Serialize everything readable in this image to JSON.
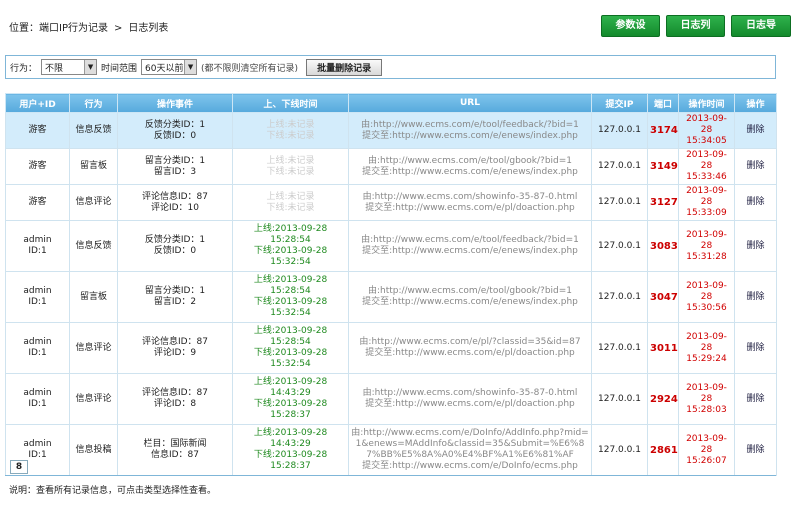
{
  "breadcrumb": {
    "prefix": "位置：",
    "parent": "端口IP行为记录",
    "sep": ">",
    "current": "日志列表"
  },
  "top_buttons": [
    "参数设置",
    "日志列表",
    "日志导出"
  ],
  "filter": {
    "behavior_label": "行为：",
    "behavior_value": "不限",
    "time_label": "时间范围",
    "time_value": "60天以前",
    "hint": "(都不限则清空所有记录)",
    "batch_delete": "批量删除记录"
  },
  "columns": [
    "用户+ID",
    "行为",
    "操作事件",
    "上、下线时间",
    "URL",
    "提交IP",
    "端口",
    "操作时间",
    "操作"
  ],
  "rows": [
    {
      "user": [
        "游客"
      ],
      "action": "信息反馈",
      "event": [
        "反馈分类ID：1",
        "反馈ID：0"
      ],
      "online": [
        "上线:未记录",
        "下线:未记录"
      ],
      "online_faded": true,
      "url_from": "由:http://www.ecms.com/e/tool/feedback/?bid=1",
      "url_to": "提交至:http://www.ecms.com/e/enews/index.php",
      "ip": "127.0.0.1",
      "port": "3174",
      "time": [
        "2013-09-28",
        "15:34:05"
      ],
      "op": "删除",
      "highlight": true
    },
    {
      "user": [
        "游客"
      ],
      "action": "留言板",
      "event": [
        "留言分类ID：1",
        "留言ID：3"
      ],
      "online": [
        "上线:未记录",
        "下线:未记录"
      ],
      "online_faded": true,
      "url_from": "由:http://www.ecms.com/e/tool/gbook/?bid=1",
      "url_to": "提交至:http://www.ecms.com/e/enews/index.php",
      "ip": "127.0.0.1",
      "port": "3149",
      "time": [
        "2013-09-28",
        "15:33:46"
      ],
      "op": "删除"
    },
    {
      "user": [
        "游客"
      ],
      "action": "信息评论",
      "event": [
        "评论信息ID：87",
        "评论ID：10"
      ],
      "online": [
        "上线:未记录",
        "下线:未记录"
      ],
      "online_faded": true,
      "url_from": "由:http://www.ecms.com/showinfo-35-87-0.html",
      "url_to": "提交至:http://www.ecms.com/e/pl/doaction.php",
      "ip": "127.0.0.1",
      "port": "3127",
      "time": [
        "2013-09-28",
        "15:33:09"
      ],
      "op": "删除"
    },
    {
      "user": [
        "admin",
        "ID:1"
      ],
      "action": "信息反馈",
      "event": [
        "反馈分类ID：1",
        "反馈ID：0"
      ],
      "online": [
        "上线:2013-09-28",
        "15:28:54",
        "下线:2013-09-28",
        "15:32:54"
      ],
      "url_from": "由:http://www.ecms.com/e/tool/feedback/?bid=1",
      "url_to": "提交至:http://www.ecms.com/e/enews/index.php",
      "ip": "127.0.0.1",
      "port": "3083",
      "time": [
        "2013-09-28",
        "15:31:28"
      ],
      "op": "删除"
    },
    {
      "user": [
        "admin",
        "ID:1"
      ],
      "action": "留言板",
      "event": [
        "留言分类ID：1",
        "留言ID：2"
      ],
      "online": [
        "上线:2013-09-28",
        "15:28:54",
        "下线:2013-09-28",
        "15:32:54"
      ],
      "url_from": "由:http://www.ecms.com/e/tool/gbook/?bid=1",
      "url_to": "提交至:http://www.ecms.com/e/enews/index.php",
      "ip": "127.0.0.1",
      "port": "3047",
      "time": [
        "2013-09-28",
        "15:30:56"
      ],
      "op": "删除"
    },
    {
      "user": [
        "admin",
        "ID:1"
      ],
      "action": "信息评论",
      "event": [
        "评论信息ID：87",
        "评论ID：9"
      ],
      "online": [
        "上线:2013-09-28",
        "15:28:54",
        "下线:2013-09-28",
        "15:32:54"
      ],
      "url_from": "由:http://www.ecms.com/e/pl/?classid=35&id=87",
      "url_to": "提交至:http://www.ecms.com/e/pl/doaction.php",
      "ip": "127.0.0.1",
      "port": "3011",
      "time": [
        "2013-09-28",
        "15:29:24"
      ],
      "op": "删除"
    },
    {
      "user": [
        "admin",
        "ID:1"
      ],
      "action": "信息评论",
      "event": [
        "评论信息ID：87",
        "评论ID：8"
      ],
      "online": [
        "上线:2013-09-28",
        "14:43:29",
        "下线:2013-09-28",
        "15:28:37"
      ],
      "url_from": "由:http://www.ecms.com/showinfo-35-87-0.html",
      "url_to": "提交至:http://www.ecms.com/e/pl/doaction.php",
      "ip": "127.0.0.1",
      "port": "2924",
      "time": [
        "2013-09-28",
        "15:28:03"
      ],
      "op": "删除"
    },
    {
      "user": [
        "admin",
        "ID:1"
      ],
      "action": "信息投稿",
      "event": [
        "栏目：国际新闻",
        "信息ID：87"
      ],
      "online": [
        "上线:2013-09-28",
        "14:43:29",
        "下线:2013-09-28",
        "15:28:37"
      ],
      "url_from": "由:http://www.ecms.com/e/DoInfo/AddInfo.php?mid=1&enews=MAddInfo&classid=35&Submit=%E6%87%BB%E5%8A%A0%E4%BF%A1%E6%81%AF",
      "url_to": "提交至:http://www.ecms.com/e/DoInfo/ecms.php",
      "ip": "127.0.0.1",
      "port": "2861",
      "time": [
        "2013-09-28",
        "15:26:07"
      ],
      "op": "删除"
    }
  ],
  "pager": "8",
  "note": "说明：查看所有记录信息，可点击类型选择性查看。"
}
